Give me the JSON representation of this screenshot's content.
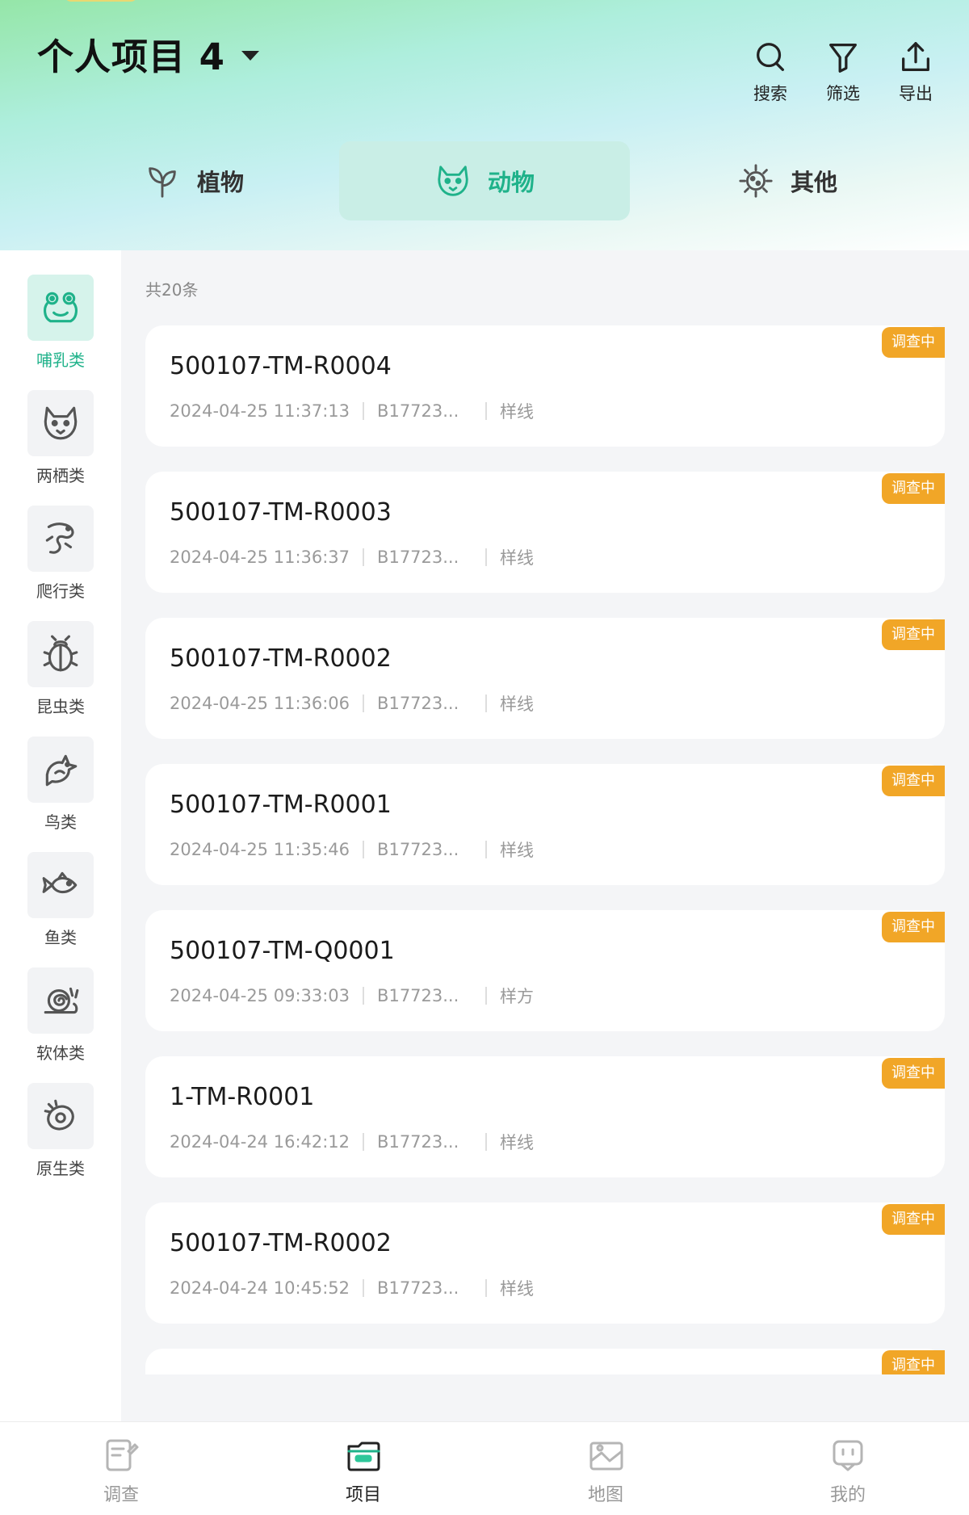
{
  "header": {
    "title": "个人项目 4",
    "tools": [
      {
        "label": "搜索",
        "icon": "search-icon"
      },
      {
        "label": "筛选",
        "icon": "filter-icon"
      },
      {
        "label": "导出",
        "icon": "export-icon"
      }
    ]
  },
  "category_tabs": [
    {
      "label": "植物",
      "icon": "plant-icon",
      "active": false
    },
    {
      "label": "动物",
      "icon": "animal-icon",
      "active": true
    },
    {
      "label": "其他",
      "icon": "microbe-icon",
      "active": false
    }
  ],
  "sidebar": {
    "items": [
      {
        "label": "哺乳类",
        "icon": "frog-face-icon",
        "active": true
      },
      {
        "label": "两栖类",
        "icon": "fox-face-icon",
        "active": false
      },
      {
        "label": "爬行类",
        "icon": "lizard-icon",
        "active": false
      },
      {
        "label": "昆虫类",
        "icon": "beetle-icon",
        "active": false
      },
      {
        "label": "鸟类",
        "icon": "bird-icon",
        "active": false
      },
      {
        "label": "鱼类",
        "icon": "fish-icon",
        "active": false
      },
      {
        "label": "软体类",
        "icon": "snail-icon",
        "active": false
      },
      {
        "label": "原生类",
        "icon": "protozoa-icon",
        "active": false
      }
    ]
  },
  "list": {
    "count_text": "共20条",
    "records": [
      {
        "title": "500107-TM-R0004",
        "datetime": "2024-04-25 11:37:13",
        "code": "B17723...",
        "type": "样线",
        "status": "调查中"
      },
      {
        "title": "500107-TM-R0003",
        "datetime": "2024-04-25 11:36:37",
        "code": "B17723...",
        "type": "样线",
        "status": "调查中"
      },
      {
        "title": "500107-TM-R0002",
        "datetime": "2024-04-25 11:36:06",
        "code": "B17723...",
        "type": "样线",
        "status": "调查中"
      },
      {
        "title": "500107-TM-R0001",
        "datetime": "2024-04-25 11:35:46",
        "code": "B17723...",
        "type": "样线",
        "status": "调查中"
      },
      {
        "title": "500107-TM-Q0001",
        "datetime": "2024-04-25 09:33:03",
        "code": "B17723...",
        "type": "样方",
        "status": "调查中"
      },
      {
        "title": "1-TM-R0001",
        "datetime": "2024-04-24 16:42:12",
        "code": "B17723...",
        "type": "样线",
        "status": "调查中"
      },
      {
        "title": "500107-TM-R0002",
        "datetime": "2024-04-24 10:45:52",
        "code": "B17723...",
        "type": "样线",
        "status": "调查中"
      },
      {
        "title": "",
        "datetime": "",
        "code": "",
        "type": "",
        "status": "调查中"
      }
    ]
  },
  "bottom_nav": [
    {
      "label": "调查",
      "icon": "survey-icon",
      "active": false
    },
    {
      "label": "项目",
      "icon": "project-folder-icon",
      "active": true
    },
    {
      "label": "地图",
      "icon": "map-icon",
      "active": false
    },
    {
      "label": "我的",
      "icon": "profile-icon",
      "active": false
    }
  ],
  "colors": {
    "accent": "#1fb28a",
    "badge": "#f1a627",
    "active_tab_bg": "#c9eee6",
    "list_bg": "#f4f5f7"
  }
}
